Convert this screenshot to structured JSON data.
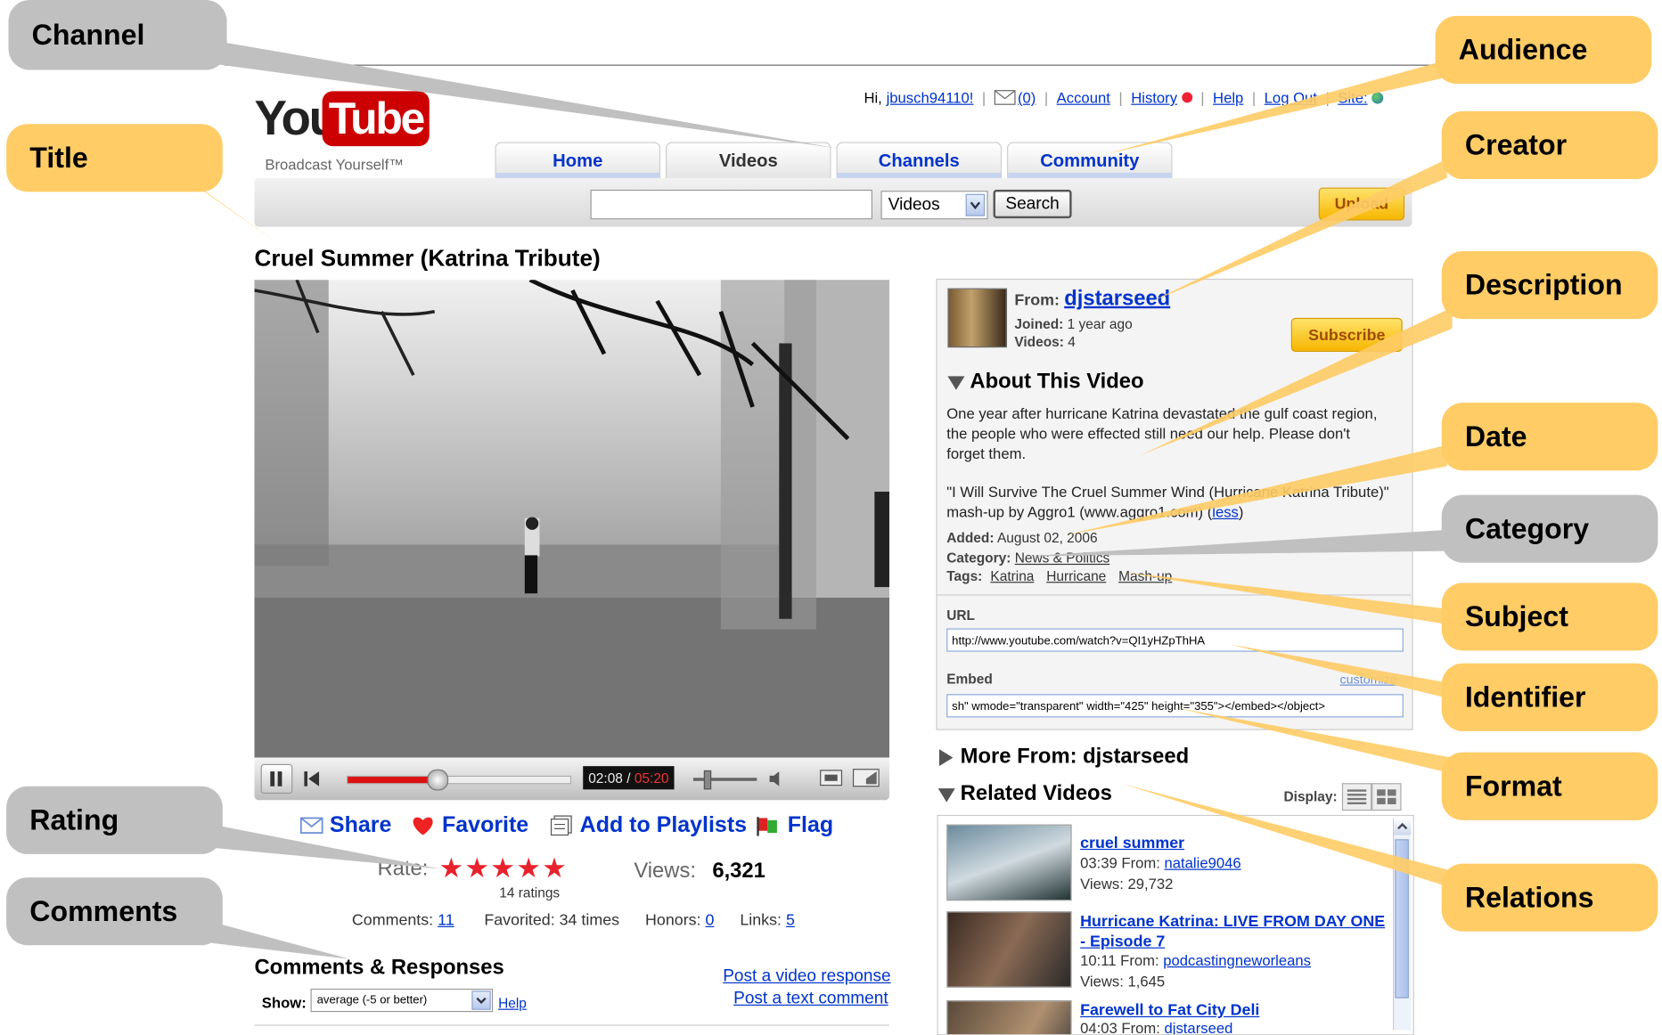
{
  "annotations": {
    "channel": "Channel",
    "title": "Title",
    "rating": "Rating",
    "comments": "Comments",
    "audience": "Audience",
    "creator": "Creator",
    "description": "Description",
    "date": "Date",
    "category": "Category",
    "subject": "Subject",
    "identifier": "Identifier",
    "format": "Format",
    "relations": "Relations"
  },
  "colors": {
    "link": "#0033cc",
    "callout_yellow": "#ffcc66",
    "callout_gray": "#c0c0c0",
    "youtube_red": "#cc0000"
  },
  "header": {
    "logo_you": "You",
    "logo_tube": "Tube",
    "tagline": "Broadcast Yourself™",
    "greeting": "Hi,",
    "username": "jbusch94110!",
    "inbox_count": "(0)",
    "links": [
      "Account",
      "History",
      "Help",
      "Log Out",
      "Site:"
    ]
  },
  "nav": {
    "tabs": [
      "Home",
      "Videos",
      "Channels",
      "Community"
    ]
  },
  "search": {
    "value": "",
    "category_selected": "Videos",
    "button": "Search",
    "upload_button": "Upload"
  },
  "video": {
    "title": "Cruel Summer (Katrina Tribute)",
    "time_elapsed": "02:08",
    "time_total": "05:20",
    "progress_fraction": 0.4
  },
  "actions": {
    "share": "Share",
    "favorite": "Favorite",
    "add_to_playlists": "Add to Playlists",
    "flag": "Flag"
  },
  "stats": {
    "rate_label": "Rate:",
    "stars": 5,
    "ratings": "14 ratings",
    "views_label": "Views:",
    "views": "6,321",
    "comments_label": "Comments:",
    "comments": "11",
    "favorited": "Favorited: 34 times",
    "honors_label": "Honors:",
    "honors": "0",
    "links_label": "Links:",
    "links": "5"
  },
  "comments_section": {
    "heading": "Comments & Responses",
    "show_label": "Show:",
    "filter": "average (-5 or better)",
    "help": "Help",
    "post_video": "Post a video response",
    "post_text": "Post a text comment"
  },
  "creator": {
    "from_label": "From:",
    "name": "djstarseed",
    "joined_label": "Joined:",
    "joined": "1 year ago",
    "videos_label": "Videos:",
    "videos": "4",
    "subscribe": "Subscribe"
  },
  "about": {
    "heading": "About This Video",
    "description": "One year after hurricane Katrina devastated the gulf coast region, the people who were effected still need our help. Please don't forget them.",
    "credit": "\"I Will Survive The Cruel Summer Wind (Hurricane Katrina Tribute)\" mash-up by Aggro1 (www.aggro1.com)",
    "less": "less",
    "added_label": "Added:",
    "added": "August 02, 2006",
    "category_label": "Category:",
    "category": "News & Politics",
    "tags_label": "Tags:",
    "tags": [
      "Katrina",
      "Hurricane",
      "Mash-up"
    ],
    "url_label": "URL",
    "url": "http://www.youtube.com/watch?v=QI1yHZpThHA",
    "embed_label": "Embed",
    "customize": "customize",
    "embed": "sh\" wmode=\"transparent\" width=\"425\" height=\"355\"></embed></object>"
  },
  "more_from": "More From: djstarseed",
  "related": {
    "heading": "Related Videos",
    "display_label": "Display:",
    "items": [
      {
        "title": "cruel summer",
        "meta": "03:39 From:",
        "from": "natalie9046",
        "views": "Views: 29,732"
      },
      {
        "title": "Hurricane Katrina: LIVE FROM DAY ONE - Episode 7",
        "meta": "10:11 From:",
        "from": "podcastingneworleans",
        "views": "Views: 1,645"
      },
      {
        "title": "Farewell to Fat City Deli",
        "meta": "04:03 From:",
        "from": "djstarseed",
        "views": ""
      }
    ]
  }
}
